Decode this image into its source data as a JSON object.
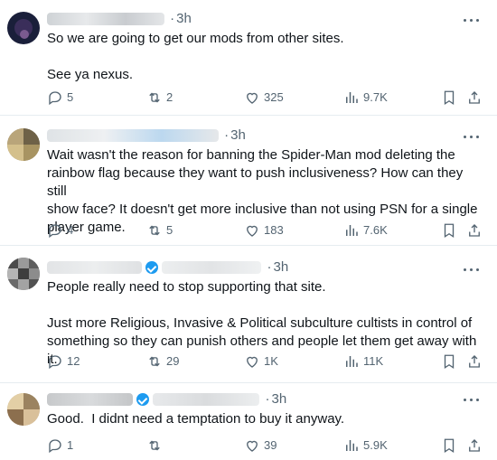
{
  "posts": [
    {
      "time": "3h",
      "lines": [
        "So we are going to get our mods from other sites.",
        "",
        "See ya nexus."
      ],
      "replies": "5",
      "reposts": "2",
      "likes": "325",
      "views": "9.7K"
    },
    {
      "time": "3h",
      "lines": [
        "Wait wasn't the reason for banning the Spider-Man mod deleting the",
        "rainbow flag because they want to push inclusiveness? How can they still",
        "show face? It doesn't get more inclusive than not using PSN for a single",
        "player game."
      ],
      "replies": "4",
      "reposts": "5",
      "likes": "183",
      "views": "7.6K"
    },
    {
      "time": "3h",
      "lines": [
        "People really need to stop supporting that site.",
        "",
        "Just more Religious, Invasive & Political subculture cultists in control of",
        "something so they can punish others and people let them get away with it."
      ],
      "replies": "12",
      "reposts": "29",
      "likes": "1K",
      "views": "11K"
    },
    {
      "time": "3h",
      "lines": [
        "Good.  I didnt need a temptation to buy it anyway."
      ],
      "replies": "1",
      "reposts": "",
      "likes": "39",
      "views": "5.9K"
    }
  ],
  "icons": {
    "reply": "reply-icon",
    "repost": "repost-icon",
    "like": "like-icon",
    "views": "views-icon",
    "bookmark": "bookmark-icon",
    "share": "share-icon",
    "more": "more-icon"
  },
  "colors": {
    "text": "#0f1419",
    "secondary": "#536471",
    "verified": "#1d9bf0",
    "divider": "#e6ecf0"
  }
}
